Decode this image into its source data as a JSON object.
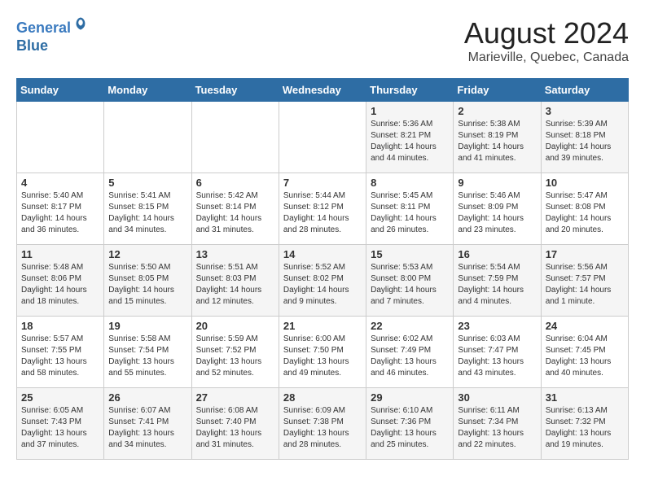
{
  "header": {
    "logo_line1": "General",
    "logo_line2": "Blue",
    "main_title": "August 2024",
    "subtitle": "Marieville, Quebec, Canada"
  },
  "weekdays": [
    "Sunday",
    "Monday",
    "Tuesday",
    "Wednesday",
    "Thursday",
    "Friday",
    "Saturday"
  ],
  "weeks": [
    [
      {
        "day": "",
        "info": ""
      },
      {
        "day": "",
        "info": ""
      },
      {
        "day": "",
        "info": ""
      },
      {
        "day": "",
        "info": ""
      },
      {
        "day": "1",
        "info": "Sunrise: 5:36 AM\nSunset: 8:21 PM\nDaylight: 14 hours\nand 44 minutes."
      },
      {
        "day": "2",
        "info": "Sunrise: 5:38 AM\nSunset: 8:19 PM\nDaylight: 14 hours\nand 41 minutes."
      },
      {
        "day": "3",
        "info": "Sunrise: 5:39 AM\nSunset: 8:18 PM\nDaylight: 14 hours\nand 39 minutes."
      }
    ],
    [
      {
        "day": "4",
        "info": "Sunrise: 5:40 AM\nSunset: 8:17 PM\nDaylight: 14 hours\nand 36 minutes."
      },
      {
        "day": "5",
        "info": "Sunrise: 5:41 AM\nSunset: 8:15 PM\nDaylight: 14 hours\nand 34 minutes."
      },
      {
        "day": "6",
        "info": "Sunrise: 5:42 AM\nSunset: 8:14 PM\nDaylight: 14 hours\nand 31 minutes."
      },
      {
        "day": "7",
        "info": "Sunrise: 5:44 AM\nSunset: 8:12 PM\nDaylight: 14 hours\nand 28 minutes."
      },
      {
        "day": "8",
        "info": "Sunrise: 5:45 AM\nSunset: 8:11 PM\nDaylight: 14 hours\nand 26 minutes."
      },
      {
        "day": "9",
        "info": "Sunrise: 5:46 AM\nSunset: 8:09 PM\nDaylight: 14 hours\nand 23 minutes."
      },
      {
        "day": "10",
        "info": "Sunrise: 5:47 AM\nSunset: 8:08 PM\nDaylight: 14 hours\nand 20 minutes."
      }
    ],
    [
      {
        "day": "11",
        "info": "Sunrise: 5:48 AM\nSunset: 8:06 PM\nDaylight: 14 hours\nand 18 minutes."
      },
      {
        "day": "12",
        "info": "Sunrise: 5:50 AM\nSunset: 8:05 PM\nDaylight: 14 hours\nand 15 minutes."
      },
      {
        "day": "13",
        "info": "Sunrise: 5:51 AM\nSunset: 8:03 PM\nDaylight: 14 hours\nand 12 minutes."
      },
      {
        "day": "14",
        "info": "Sunrise: 5:52 AM\nSunset: 8:02 PM\nDaylight: 14 hours\nand 9 minutes."
      },
      {
        "day": "15",
        "info": "Sunrise: 5:53 AM\nSunset: 8:00 PM\nDaylight: 14 hours\nand 7 minutes."
      },
      {
        "day": "16",
        "info": "Sunrise: 5:54 AM\nSunset: 7:59 PM\nDaylight: 14 hours\nand 4 minutes."
      },
      {
        "day": "17",
        "info": "Sunrise: 5:56 AM\nSunset: 7:57 PM\nDaylight: 14 hours\nand 1 minute."
      }
    ],
    [
      {
        "day": "18",
        "info": "Sunrise: 5:57 AM\nSunset: 7:55 PM\nDaylight: 13 hours\nand 58 minutes."
      },
      {
        "day": "19",
        "info": "Sunrise: 5:58 AM\nSunset: 7:54 PM\nDaylight: 13 hours\nand 55 minutes."
      },
      {
        "day": "20",
        "info": "Sunrise: 5:59 AM\nSunset: 7:52 PM\nDaylight: 13 hours\nand 52 minutes."
      },
      {
        "day": "21",
        "info": "Sunrise: 6:00 AM\nSunset: 7:50 PM\nDaylight: 13 hours\nand 49 minutes."
      },
      {
        "day": "22",
        "info": "Sunrise: 6:02 AM\nSunset: 7:49 PM\nDaylight: 13 hours\nand 46 minutes."
      },
      {
        "day": "23",
        "info": "Sunrise: 6:03 AM\nSunset: 7:47 PM\nDaylight: 13 hours\nand 43 minutes."
      },
      {
        "day": "24",
        "info": "Sunrise: 6:04 AM\nSunset: 7:45 PM\nDaylight: 13 hours\nand 40 minutes."
      }
    ],
    [
      {
        "day": "25",
        "info": "Sunrise: 6:05 AM\nSunset: 7:43 PM\nDaylight: 13 hours\nand 37 minutes."
      },
      {
        "day": "26",
        "info": "Sunrise: 6:07 AM\nSunset: 7:41 PM\nDaylight: 13 hours\nand 34 minutes."
      },
      {
        "day": "27",
        "info": "Sunrise: 6:08 AM\nSunset: 7:40 PM\nDaylight: 13 hours\nand 31 minutes."
      },
      {
        "day": "28",
        "info": "Sunrise: 6:09 AM\nSunset: 7:38 PM\nDaylight: 13 hours\nand 28 minutes."
      },
      {
        "day": "29",
        "info": "Sunrise: 6:10 AM\nSunset: 7:36 PM\nDaylight: 13 hours\nand 25 minutes."
      },
      {
        "day": "30",
        "info": "Sunrise: 6:11 AM\nSunset: 7:34 PM\nDaylight: 13 hours\nand 22 minutes."
      },
      {
        "day": "31",
        "info": "Sunrise: 6:13 AM\nSunset: 7:32 PM\nDaylight: 13 hours\nand 19 minutes."
      }
    ]
  ]
}
